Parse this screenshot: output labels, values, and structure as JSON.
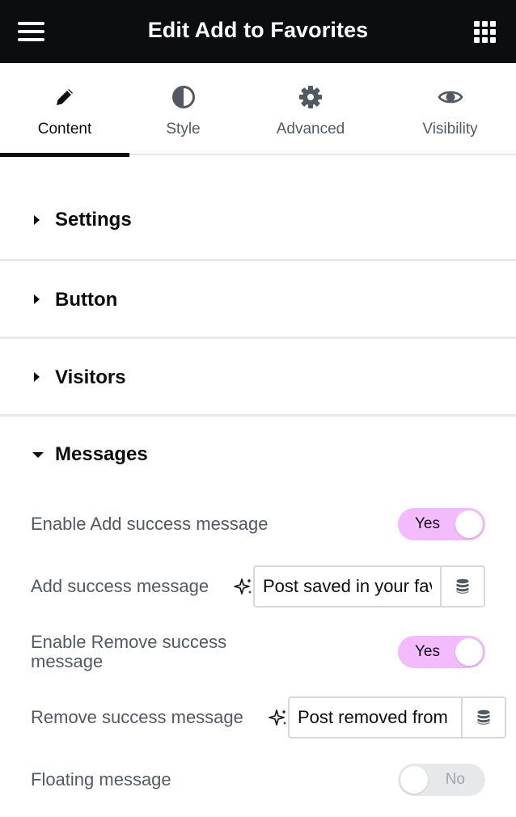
{
  "header": {
    "title": "Edit Add to Favorites",
    "menu_icon": "hamburger-icon",
    "apps_icon": "grid-icon"
  },
  "tabs": [
    {
      "label": "Content",
      "icon": "pencil-icon",
      "active": true
    },
    {
      "label": "Style",
      "icon": "half-circle-icon",
      "active": false
    },
    {
      "label": "Advanced",
      "icon": "gear-icon",
      "active": false
    },
    {
      "label": "Visibility",
      "icon": "eye-icon",
      "active": false
    }
  ],
  "sections": {
    "settings": {
      "title": "Settings",
      "expanded": false
    },
    "button": {
      "title": "Button",
      "expanded": false
    },
    "visitors": {
      "title": "Visitors",
      "expanded": false
    },
    "messages": {
      "title": "Messages",
      "expanded": true
    }
  },
  "messages": {
    "enable_add": {
      "label": "Enable Add success message",
      "state": "Yes"
    },
    "add_message": {
      "label": "Add success message",
      "value": "Post saved in your favorites"
    },
    "enable_remove": {
      "label_line1": "Enable Remove success",
      "label_line2": "message",
      "state": "Yes"
    },
    "remove_message": {
      "label": "Remove success message",
      "value": "Post removed from your favorites"
    },
    "floating": {
      "label": "Floating message",
      "state": "No"
    }
  },
  "colors": {
    "header_bg": "#0c0d0e",
    "toggle_on": "#f3bafd",
    "toggle_off": "#e6e8ea"
  }
}
